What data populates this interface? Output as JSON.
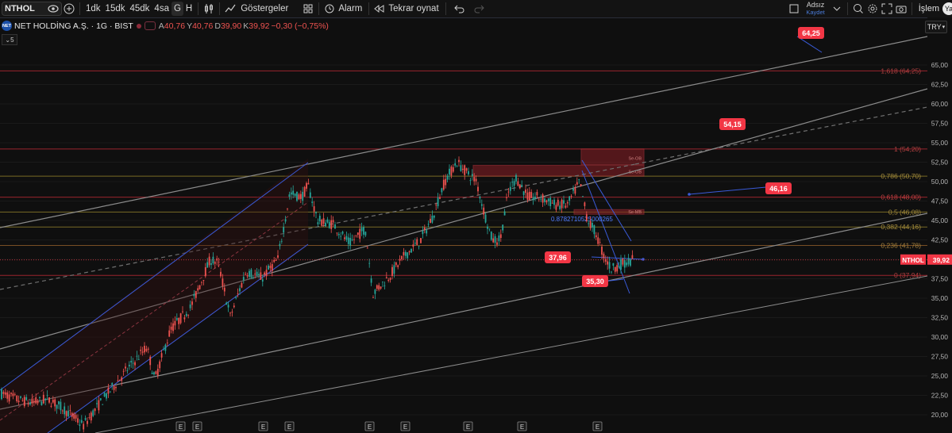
{
  "toolbar": {
    "symbol": "NTHOL",
    "timeframes": [
      "1dk",
      "15dk",
      "45dk",
      "4sa",
      "G",
      "H"
    ],
    "active_timeframe": "G",
    "indicators_label": "Göstergeler",
    "alarm_label": "Alarm",
    "replay_label": "Tekrar oynat",
    "layout_name": "Adsız",
    "save_label": "Kaydet",
    "trade_label": "İşlem",
    "avatar_letter": "Ya"
  },
  "legend": {
    "logo_text": "NET",
    "title": "NET HOLDİNG A.Ş. · 1G · BIST",
    "open_key": "A",
    "open": "40,76",
    "high_key": "Y",
    "high": "40,76",
    "low_key": "D",
    "low": "39,90",
    "close_key": "K",
    "close": "39,92",
    "change": "−0,30 (−0,75%)",
    "indicator_count": "5"
  },
  "currency": "TRY",
  "colors": {
    "up": "#26a69a",
    "down": "#ef5350",
    "accent": "#f23645",
    "line_blue": "#2962ff",
    "fib_red": "#b22833"
  },
  "price_axis": {
    "ticks": [
      "65,00",
      "62,50",
      "60,00",
      "57,50",
      "55,00",
      "52,50",
      "50,00",
      "47,50",
      "45,00",
      "42,50",
      "40,00",
      "37,50",
      "35,00",
      "32,50",
      "30,00",
      "27,50",
      "25,00",
      "22,50",
      "20,00"
    ],
    "last_symbol": "NTHOL",
    "last_price": "39,92"
  },
  "fib_levels": [
    {
      "label": "1,618 (64,25)",
      "value": 64.25
    },
    {
      "label": "1 (54,20)",
      "value": 54.2
    },
    {
      "label": "0,786 (50,70)",
      "value": 50.7
    },
    {
      "label": "0,618 (48,00)",
      "value": 48.0
    },
    {
      "label": "0,5 (46,08)",
      "value": 46.08
    },
    {
      "label": "0,382 (44,16)",
      "value": 44.16
    },
    {
      "label": "0,236 (41,78)",
      "value": 41.78
    },
    {
      "label": "0 (37,94)",
      "value": 37.94
    }
  ],
  "callouts": [
    {
      "text": "64,25",
      "value": 64.25
    },
    {
      "text": "54,15",
      "value": 54.15
    },
    {
      "text": "46,16",
      "value": 46.16
    },
    {
      "text": "37,96",
      "value": 37.96
    },
    {
      "text": "35,30",
      "value": 35.3
    }
  ],
  "annotation_text": "0.8782710525000265",
  "zone_labels": [
    "Se-OB",
    "Se-OB",
    "Se-MB"
  ],
  "earnings_marker": "E"
}
